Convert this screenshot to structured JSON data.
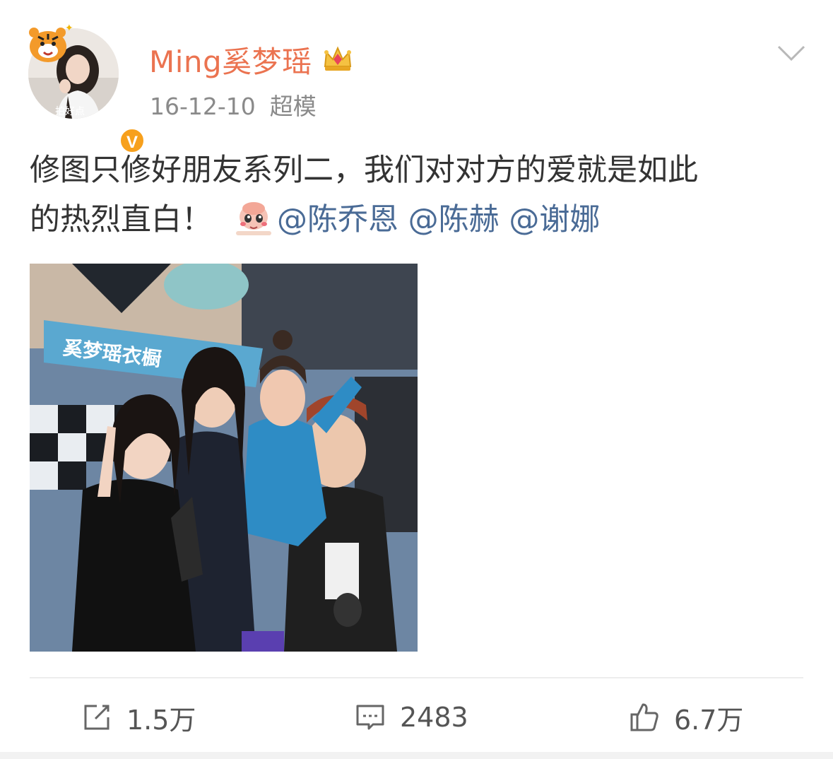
{
  "post": {
    "author": {
      "name": "Ming奚梦瑶",
      "avatar_icon": "avatar-photo",
      "badge_icon": "tiger-sticker-icon",
      "verified_label": "V",
      "member_icon": "crown-icon"
    },
    "date": "16-12-10",
    "source": "超模",
    "text": {
      "line1": "修图只修好朋友系列二，我们对对方的爱就是如此",
      "line2": "的热烈直白！",
      "emoji_icon": "shy-face-emoji-icon",
      "mentions": [
        "@陈乔恩",
        "@陈赫",
        "@谢娜"
      ]
    },
    "photo": {
      "icon": "group-photo"
    },
    "actions": {
      "repost": {
        "icon": "share-icon",
        "count": "1.5万"
      },
      "comment": {
        "icon": "comment-icon",
        "count": "2483"
      },
      "like": {
        "icon": "thumbs-up-icon",
        "count": "6.7万"
      }
    },
    "colors": {
      "username": "#eb7350",
      "mention": "#4a6b96",
      "meta": "#8a8a8a",
      "verified": "#f7a01c"
    }
  }
}
